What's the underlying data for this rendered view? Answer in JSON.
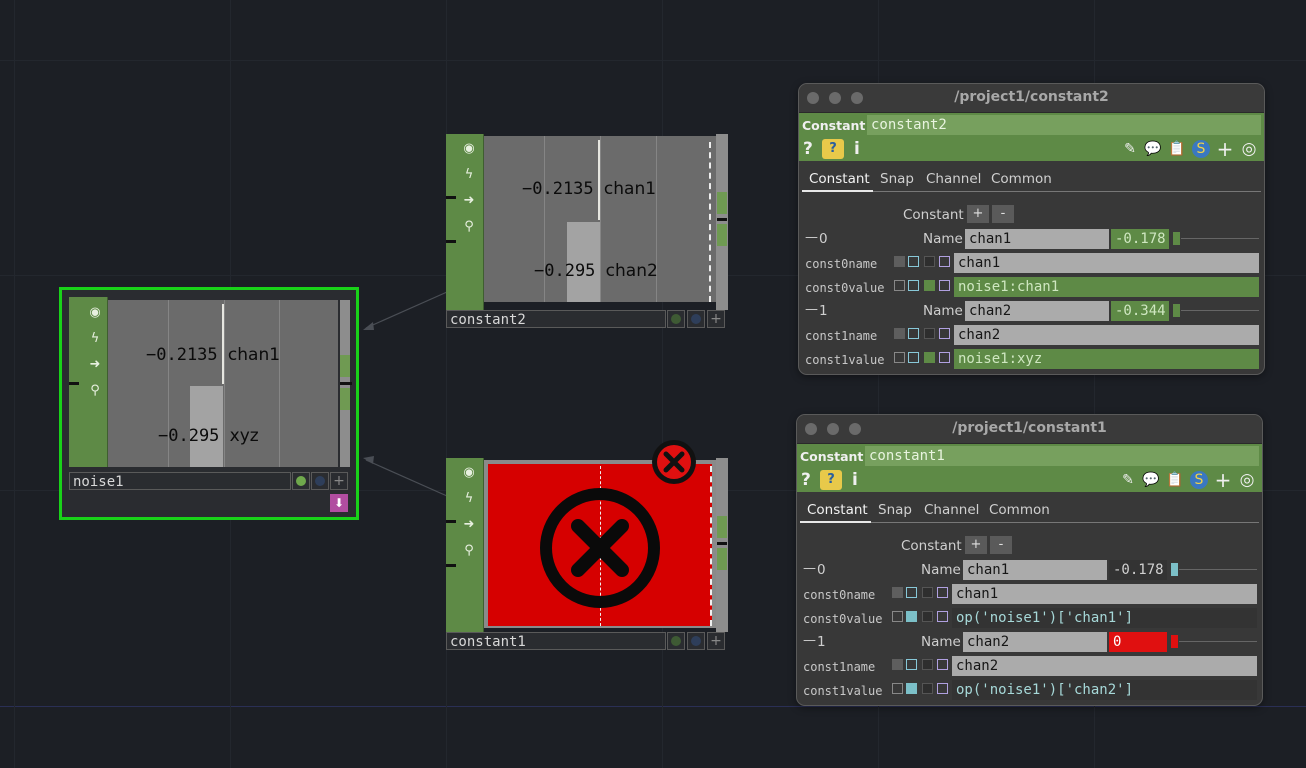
{
  "nodes": {
    "noise1": {
      "name": "noise1",
      "channels": [
        {
          "value": "−0.2135",
          "name": "chan1"
        },
        {
          "value": "−0.295",
          "name": "xyz"
        }
      ]
    },
    "constant2": {
      "name": "constant2",
      "channels": [
        {
          "value": "−0.2135",
          "name": "chan1"
        },
        {
          "value": "−0.295",
          "name": "chan2"
        }
      ]
    },
    "constant1": {
      "name": "constant1",
      "error_icon": "error-x-icon"
    }
  },
  "panels": {
    "constant2": {
      "title": "/project1/constant2",
      "op_type": "Constant",
      "op_name": "constant2",
      "toolbar": {
        "help": "?",
        "python_help": "python-help-icon",
        "info": "i"
      },
      "tabs": [
        "Constant",
        "Snap",
        "Channel",
        "Common"
      ],
      "active_tab": "Constant",
      "seq_label": "Constant",
      "seq_add": "+",
      "seq_remove": "-",
      "blocks": [
        {
          "index": "0",
          "name_label": "Name",
          "name_value": "chan1",
          "value": "-0.178",
          "const_name_label": "const0name",
          "const_name_value": "chan1",
          "const_value_label": "const0value",
          "const_value_value": "noise1:chan1"
        },
        {
          "index": "1",
          "name_label": "Name",
          "name_value": "chan2",
          "value": "-0.344",
          "const_name_label": "const1name",
          "const_name_value": "chan2",
          "const_value_label": "const1value",
          "const_value_value": "noise1:xyz"
        }
      ]
    },
    "constant1": {
      "title": "/project1/constant1",
      "op_type": "Constant",
      "op_name": "constant1",
      "toolbar": {
        "help": "?",
        "python_help": "python-help-icon",
        "info": "i"
      },
      "tabs": [
        "Constant",
        "Snap",
        "Channel",
        "Common"
      ],
      "active_tab": "Constant",
      "seq_label": "Constant",
      "seq_add": "+",
      "seq_remove": "-",
      "blocks": [
        {
          "index": "0",
          "name_label": "Name",
          "name_value": "chan1",
          "value": "-0.178",
          "const_name_label": "const0name",
          "const_name_value": "chan1",
          "const_value_label": "const0value",
          "const_value_value": "op('noise1')['chan1']"
        },
        {
          "index": "1",
          "name_label": "Name",
          "name_value": "chan2",
          "value": "0",
          "value_state": "error",
          "const_name_label": "const1name",
          "const_name_value": "chan2",
          "const_value_label": "const1value",
          "const_value_value": "op('noise1')['chan2']"
        }
      ]
    }
  },
  "colors": {
    "background": "#1c1f25",
    "op_green": "#5e8a46",
    "selected_outline": "#19d219",
    "error_red": "#e01010"
  }
}
